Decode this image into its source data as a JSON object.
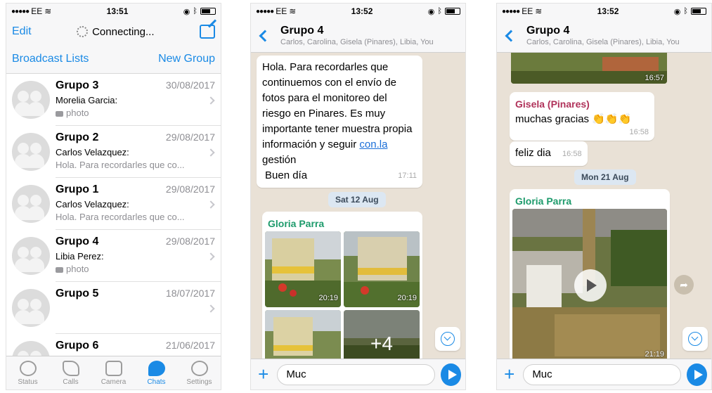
{
  "colors": {
    "accent": "#1a8ae5",
    "chat_bg": "#e9e1d6",
    "sender_gisela": "#b0325a",
    "sender_gloria": "#1e9b6c"
  },
  "screen1": {
    "status": {
      "carrier": "EE",
      "time": "13:51"
    },
    "nav": {
      "edit": "Edit",
      "connecting": "Connecting...",
      "compose_icon": "compose-icon"
    },
    "bar": {
      "broadcast": "Broadcast Lists",
      "new_group": "New Group"
    },
    "chats": [
      {
        "name": "Grupo 3",
        "date": "30/08/2017",
        "sender": "Morelia Garcia:",
        "preview": "photo",
        "photo": true
      },
      {
        "name": "Grupo 2",
        "date": "29/08/2017",
        "sender": "Carlos Velazquez:",
        "preview": "Hola. Para recordarles que co...",
        "photo": false
      },
      {
        "name": "Grupo 1",
        "date": "29/08/2017",
        "sender": "Carlos Velazquez:",
        "preview": "Hola. Para recordarles que co...",
        "photo": false
      },
      {
        "name": "Grupo 4",
        "date": "29/08/2017",
        "sender": "Libia Perez:",
        "preview": "photo",
        "photo": true
      },
      {
        "name": "Grupo 5",
        "date": "18/07/2017",
        "sender": "",
        "preview": "",
        "photo": false
      },
      {
        "name": "Grupo 6",
        "date": "21/06/2017",
        "sender": "",
        "preview": "",
        "photo": false
      }
    ],
    "tabs": [
      "Status",
      "Calls",
      "Camera",
      "Chats",
      "Settings"
    ]
  },
  "screen2": {
    "status": {
      "carrier": "EE",
      "time": "13:52"
    },
    "header": {
      "title": "Grupo 4",
      "subtitle": "Carlos, Carolina, Gisela (Pinares), Libia, You"
    },
    "message": {
      "text": "Hola. Para recordarles que continuemos con el envío de fotos para el monitoreo del riesgo en Pinares. Es muy importante tener muestra propia información y seguir",
      "link": "con.la",
      "text_after_link": " gestión",
      "closing": "Buen día",
      "time": "17:11"
    },
    "day": "Sat 12 Aug",
    "photo_msg": {
      "sender": "Gloria Parra",
      "time1": "20:19",
      "time2": "20:19",
      "more": "+4"
    },
    "input": {
      "value": "Muc"
    }
  },
  "screen3": {
    "status": {
      "carrier": "EE",
      "time": "13:52"
    },
    "header": {
      "title": "Grupo 4",
      "subtitle": "Carlos, Carolina, Gisela (Pinares), Libia, You"
    },
    "top_photo_time": "16:57",
    "msg1": {
      "sender": "Gisela (Pinares)",
      "text": "muchas gracias 👏👏👏",
      "time": "16:58"
    },
    "msg2": {
      "text": "feliz dia",
      "time": "16:58"
    },
    "day": "Mon 21 Aug",
    "video_msg": {
      "sender": "Gloria Parra",
      "time": "21:19"
    },
    "input": {
      "value": "Muc"
    }
  }
}
